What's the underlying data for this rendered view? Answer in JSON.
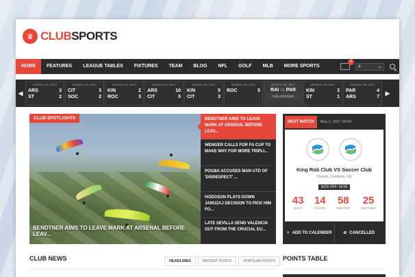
{
  "brand": {
    "logo_prefix": "CLUB",
    "logo_suffix": "SPORTS"
  },
  "nav": {
    "items": [
      "Home",
      "Features",
      "League Tables",
      "Fixtures",
      "Team",
      "Blog",
      "NFL",
      "Golf",
      "MLB",
      "More Sports"
    ],
    "cart_count": "0",
    "language": "a"
  },
  "ticker": {
    "prev_icon": "chevron-left-icon",
    "next_icon": "chevron-right-icon",
    "matches": [
      {
        "date": "MARCH 19, 2017",
        "t1": "ARS",
        "s1": "3",
        "t2": "ST",
        "s2": "2"
      },
      {
        "date": "MARCH 19, 2017",
        "t1": "CIT",
        "s1": "3",
        "t2": "SOC",
        "s2": "2"
      },
      {
        "date": "MARCH 19, 2017",
        "t1": "KIN",
        "s1": "2",
        "t2": "ROC",
        "s2": "3"
      },
      {
        "date": "MARCH 19, 2017",
        "t1": "ARS",
        "s1": "10",
        "t2": "CIT",
        "s2": "5"
      },
      {
        "date": "MARCH 19, 2017",
        "t1": "KIN",
        "s1": "5",
        "t2": "CIT",
        "s2": "3"
      },
      {
        "date": "MARCH 19, 2017",
        "t1": "ROC",
        "s1": "5",
        "t2": "",
        "s2": ""
      },
      {
        "date": "MARCH 19, 2017",
        "vs_a": "RAI",
        "vs_sep": "VS",
        "vs_b": "PAR",
        "status": "FULL BOOKED"
      },
      {
        "date": "MARCH 19, 2017",
        "t1": "KIN",
        "s1": "3",
        "t2": "ST",
        "s2": "1"
      },
      {
        "date": "MARCH 19, 2017",
        "t1": "PAR",
        "s1": "4",
        "t2": "ARS",
        "s2": "7"
      }
    ]
  },
  "hero": {
    "label": "Club Spotlights",
    "title": "Bendtner aims to leave mark at Arsenal before leav..."
  },
  "side_news": [
    "Bendtner aims to leave mark at Arsenal before leav...",
    "Wenger calls for FA Cup to make way for more tripli...",
    "Pogba accuses Man Utd of 'disrespect' ...",
    "Hodgson plays down Januzaj decision to pick him fo...",
    "Late Sevilla send Valencia out from the crucial Eu..."
  ],
  "next_match": {
    "label": "Next Match",
    "date": "May 2, 2017 04:00",
    "teams": "King Rob Club VS Soccer Club",
    "place": "Cleator, Cumbria, UK",
    "kickoff": "KICK-OFF: 04:00",
    "countdown": {
      "days": "43",
      "days_label": "Days",
      "hours": "14",
      "hours_label": "Hours",
      "minutes": "58",
      "minutes_label": "Minutes",
      "seconds": "25",
      "seconds_label": "Seconds"
    },
    "add_label": "Add to Calender",
    "cancel_label": "Cancelled"
  },
  "club_news": {
    "title": "Club News",
    "tabs": [
      "Headlines",
      "Recent Posts",
      "Popular Posts"
    ]
  },
  "points_table": {
    "title": "Points Table"
  },
  "colors": {
    "accent": "#e7473b",
    "dark": "#2b2b2b",
    "team_blue": "#2f8fd6",
    "team_green": "#66c17a"
  }
}
